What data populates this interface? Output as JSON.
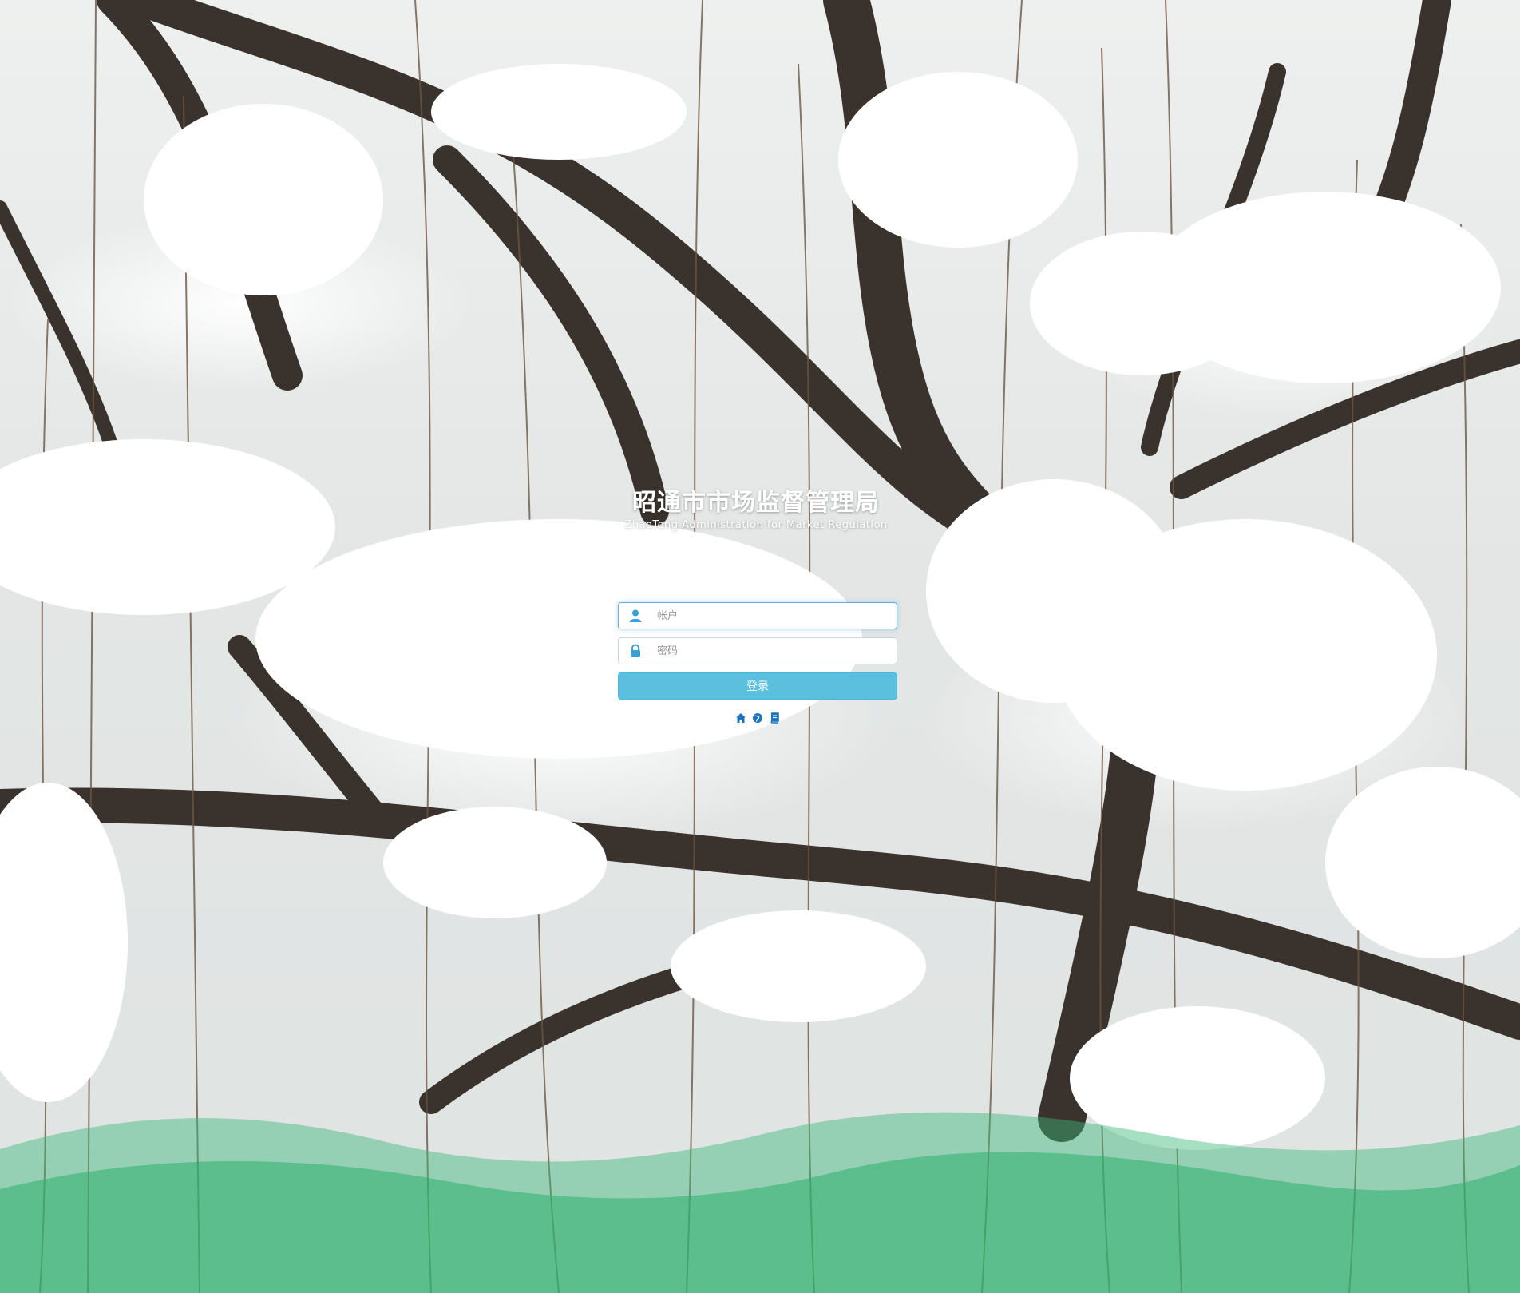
{
  "brand": {
    "title": "昭通市市场监督管理局",
    "subtitle": "ZhaoTong Administration for Market Regulation"
  },
  "login": {
    "account_placeholder": "帐户",
    "password_placeholder": "密码",
    "submit_label": "登录"
  },
  "links": [
    {
      "icon": "home-icon"
    },
    {
      "icon": "globe-icon"
    },
    {
      "icon": "book-icon"
    }
  ],
  "colors": {
    "accent": "#5bc0de",
    "icon": "#3a9fd6",
    "wave": "#3bb97a"
  }
}
